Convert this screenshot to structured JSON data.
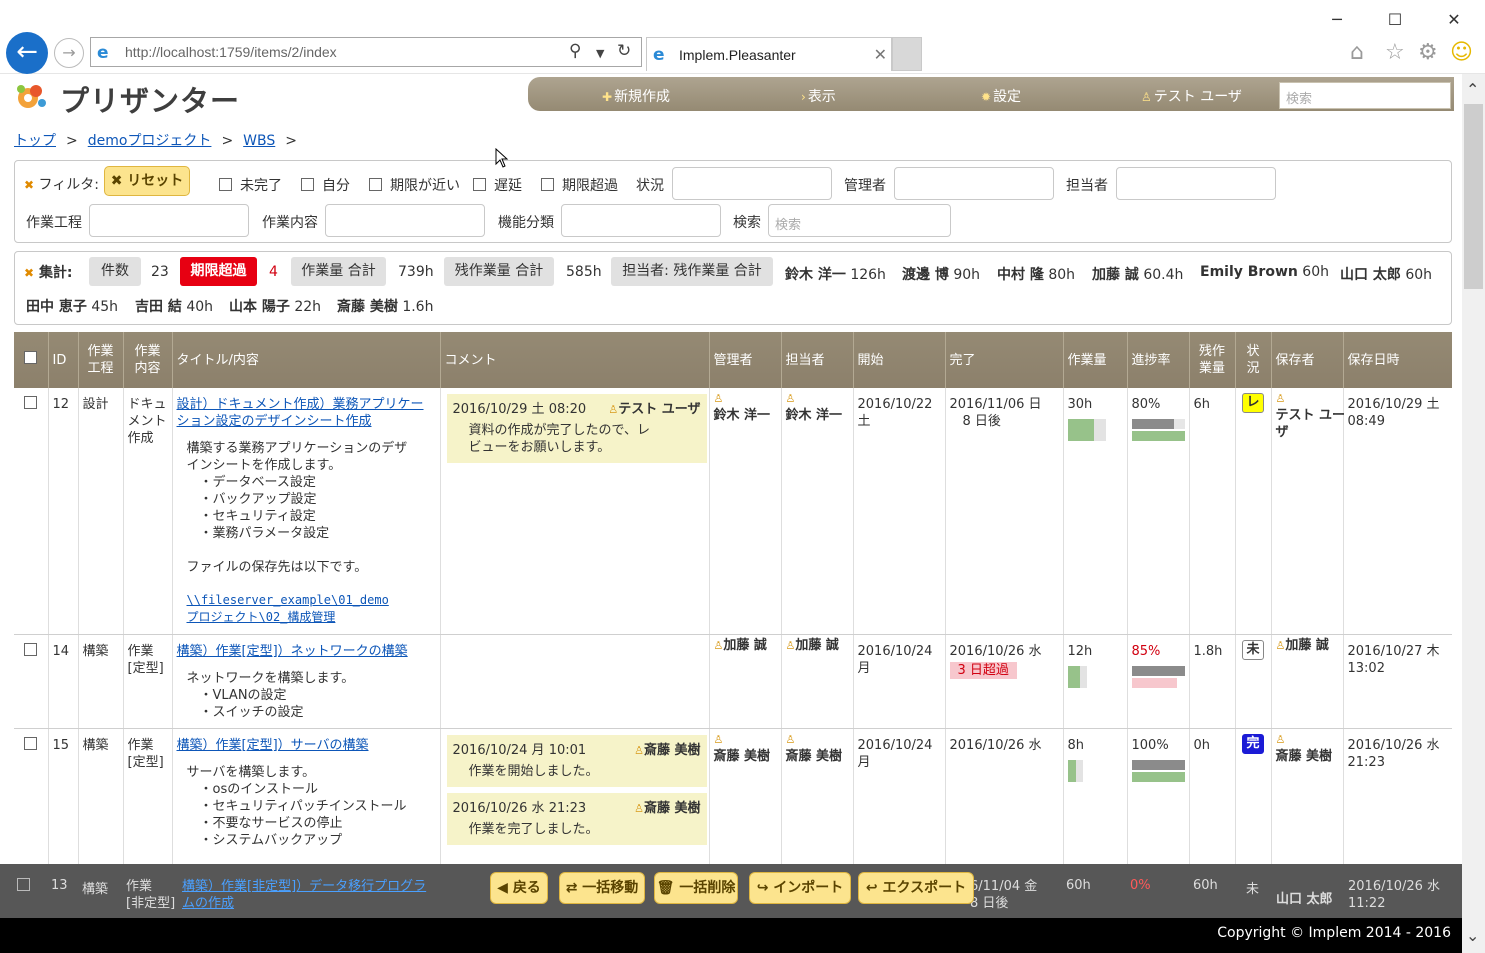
{
  "browser": {
    "url": "http://localhost:1759/items/2/index",
    "tab_title": "Implem.Pleasanter",
    "window": {
      "minimize": "─",
      "maximize": "☐",
      "close": "✕"
    }
  },
  "app": {
    "logo_text": "プリザンター",
    "nav": {
      "new": "新規作成",
      "view": "表示",
      "settings": "設定",
      "user": "テスト ユーザ",
      "search_placeholder": "検索"
    }
  },
  "breadcrumb": {
    "items": [
      "トップ",
      "demoプロジェクト",
      "WBS"
    ],
    "sep": ">"
  },
  "filter": {
    "label": "フィルタ:",
    "reset": "リセット",
    "checkboxes": [
      "未完了",
      "自分",
      "期限が近い",
      "遅延",
      "期限超過"
    ],
    "status_label": "状況",
    "manager_label": "管理者",
    "owner_label": "担当者",
    "work_process_label": "作業工程",
    "work_content_label": "作業内容",
    "feature_label": "機能分類",
    "search_label": "検索",
    "search_placeholder": "検索"
  },
  "summary": {
    "label": "集計:",
    "count_label": "件数",
    "count": "23",
    "overdue_label": "期限超過",
    "overdue": "4",
    "work_total_label": "作業量 合計",
    "work_total": "739h",
    "remain_total_label": "残作業量 合計",
    "remain_total": "585h",
    "by_owner_label": "担当者: 残作業量 合計",
    "people": [
      {
        "name": "鈴木 洋一",
        "value": "126h"
      },
      {
        "name": "渡邊 博",
        "value": "90h"
      },
      {
        "name": "中村 隆",
        "value": "80h"
      },
      {
        "name": "加藤 誠",
        "value": "60.4h"
      },
      {
        "name": "Emily Brown",
        "value": "60h"
      },
      {
        "name": "山口 太郎",
        "value": "60h"
      },
      {
        "name": "田中 恵子",
        "value": "45h"
      },
      {
        "name": "吉田 結",
        "value": "40h"
      },
      {
        "name": "山本 陽子",
        "value": "22h"
      },
      {
        "name": "斎藤 美樹",
        "value": "1.6h"
      }
    ]
  },
  "grid": {
    "headers": {
      "id": "ID",
      "process": "作業\n工程",
      "content": "作業\n内容",
      "title": "タイトル/内容",
      "comment": "コメント",
      "manager": "管理者",
      "owner": "担当者",
      "start": "開始",
      "end": "完了",
      "work": "作業量",
      "progress": "進捗率",
      "remain": "残作\n業量",
      "status": "状\n況",
      "updater": "保存者",
      "updated": "保存日時"
    },
    "rows": [
      {
        "id": "12",
        "process": "設計",
        "content": "ドキュメント作成",
        "title": "設計）ドキュメント作成）業務アプリケーション設定のデザインシート作成",
        "body": "構築する業務アプリケーションのデザ\nインシートを作成します。\n　・データベース設定\n　・バックアップ設定\n　・セキュリティ設定\n　・業務パラメータ設定\n\nファイルの保存先は以下です。",
        "file_link": "\\\\fileserver_example\\01_demo\nプロジェクト\\02_構成管理",
        "comments": [
          {
            "time": "2016/10/29 土 08:20",
            "by": "テスト ユーザ",
            "body": "資料の作成が完了したので、レ\nビューをお願いします。"
          }
        ],
        "manager": "鈴木 洋一",
        "owner": "鈴木 洋一",
        "start": "2016/10/22\n土",
        "end": "2016/11/06 日\n　8 日後",
        "end_overdue": "",
        "work": "30h",
        "work_ratio": 0.8,
        "progress": "80%",
        "progress_value": 0.8,
        "progress_red": false,
        "remain": "6h",
        "status": "レ",
        "status_style": "yellow",
        "updater": "テスト ユー\nザ",
        "updated": "2016/10/29 土\n08:49"
      },
      {
        "id": "14",
        "process": "構築",
        "content": "作業\n[定型]",
        "title": "構築）作業[定型]）ネットワークの構築",
        "body": "ネットワークを構築します。\n　・VLANの設定\n　・スイッチの設定",
        "file_link": "",
        "comments": [],
        "manager": "加藤 誠",
        "owner": "加藤 誠",
        "start": "2016/10/24\n月",
        "end": "2016/10/26 水",
        "end_overdue": "3 日超過",
        "work": "12h",
        "work_ratio": 0.35,
        "progress": "85%",
        "progress_value": 1.0,
        "progress_red": true,
        "remain": "1.8h",
        "status": "未",
        "status_style": "white",
        "updater": "加藤 誠",
        "updated": "2016/10/27 木\n13:02"
      },
      {
        "id": "15",
        "process": "構築",
        "content": "作業\n[定型]",
        "title": "構築）作業[定型]）サーバの構築",
        "body": "サーバを構築します。\n　・osのインストール\n　・セキュリティパッチインストール\n　・不要なサービスの停止\n　・システムバックアップ",
        "file_link": "",
        "comments": [
          {
            "time": "2016/10/24 月 10:01",
            "by": "斎藤 美樹",
            "body": "作業を開始しました。"
          },
          {
            "time": "2016/10/26 水 21:23",
            "by": "斎藤 美樹",
            "body": "作業を完了しました。"
          }
        ],
        "manager": "斎藤 美樹",
        "owner": "斎藤 美樹",
        "start": "2016/10/24\n月",
        "end": "2016/10/26 水",
        "end_overdue": "",
        "work": "8h",
        "work_ratio": 0.25,
        "progress": "100%",
        "progress_value": 1.0,
        "progress_red": false,
        "remain": "0h",
        "status": "完",
        "status_style": "blue",
        "updater": "斎藤 美樹",
        "updated": "2016/10/26 水\n21:23"
      }
    ],
    "partial_row": {
      "id": "13",
      "process": "構築",
      "content": "作業\n[非定型]",
      "title": "構築）作業[非定型]）データ移行プログラムの作成",
      "end": "6/11/04 金\n8 日後",
      "work": "60h",
      "progress": "0%",
      "remain": "60h",
      "status": "未",
      "updater": "山口 太郎",
      "updated": "2016/10/26 水\n11:22"
    }
  },
  "actions": {
    "back": "戻る",
    "bulk_move": "一括移動",
    "bulk_delete": "一括削除",
    "import": "インポート",
    "export": "エクスポート"
  },
  "footer": {
    "copyright": "Copyright © Implem 2014 - 2016"
  },
  "colors": {
    "navbar": "#958a73",
    "accent_button": "#fce48e",
    "overdue_red": "#e70012",
    "work_bar": "#97c28a",
    "status_blue": "#1b1bd6"
  }
}
